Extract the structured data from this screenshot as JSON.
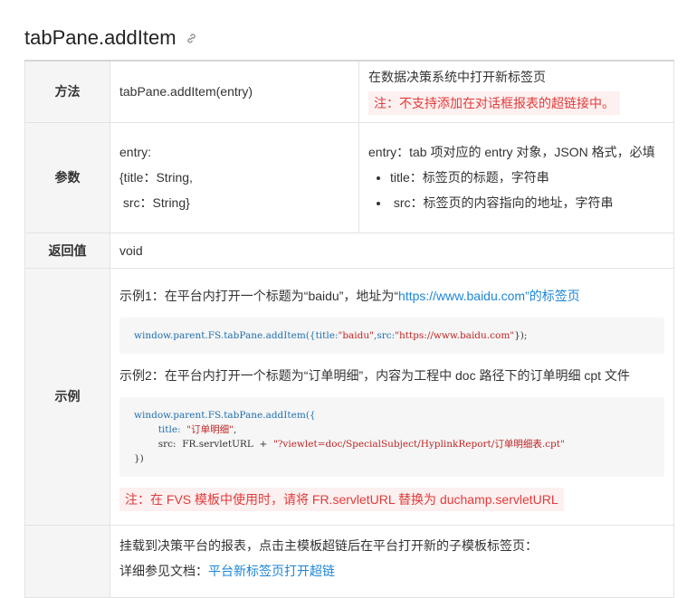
{
  "title": "tabPane.addItem",
  "rows": {
    "method": {
      "label": "方法",
      "signature": "tabPane.addItem(entry)",
      "desc": "在数据决策系统中打开新标签页",
      "warn": "注：不支持添加在对话框报表的超链接中。"
    },
    "params": {
      "label": "参数",
      "lines": [
        "entry:",
        "{title：String,",
        " src：String}"
      ],
      "desc": "entry：tab 项对应的 entry 对象，JSON 格式，必填",
      "bullets": [
        "title：标签页的标题，字符串",
        " src：标签页的内容指向的地址，字符串"
      ]
    },
    "returns": {
      "label": "返回值",
      "value": "void"
    },
    "example": {
      "label": "示例",
      "ex1_prefix": "示例1：在平台内打开一个标题为“baidu”，地址为“",
      "ex1_link": "https://www.baidu.com",
      "ex1_suffix": "”的标签页",
      "code1_pre": "window.parent.FS.tabPane.addItem({title:",
      "code1_s1": "\"baidu\"",
      "code1_mid": ",src:",
      "code1_s2": "\"https://www.baidu.com\"",
      "code1_post": "});",
      "ex2": "示例2：在平台内打开一个标题为“订单明细”，内容为工程中 doc 路径下的订单明细 cpt 文件",
      "code2_l1": "window.parent.FS.tabPane.addItem({",
      "code2_l2_key": "        title:  ",
      "code2_l2_val": "\"订单明细\"",
      "code2_l2_end": ",",
      "code2_l3_key": "        src:  FR.servletURL  +  ",
      "code2_l3_val": "\"?viewlet=doc/SpecialSubject/HyplinkReport/订单明细表.cpt\"",
      "code2_l4": "})",
      "warn": "注：在 FVS 模板中使用时，请将 FR.servletURL 替换为 duchamp.servletURL"
    },
    "last": {
      "line1": "挂载到决策平台的报表，点击主模板超链后在平台打开新的子模板标签页：",
      "line2_prefix": "详细参见文档：",
      "line2_link": "平台新标签页打开超链"
    }
  }
}
